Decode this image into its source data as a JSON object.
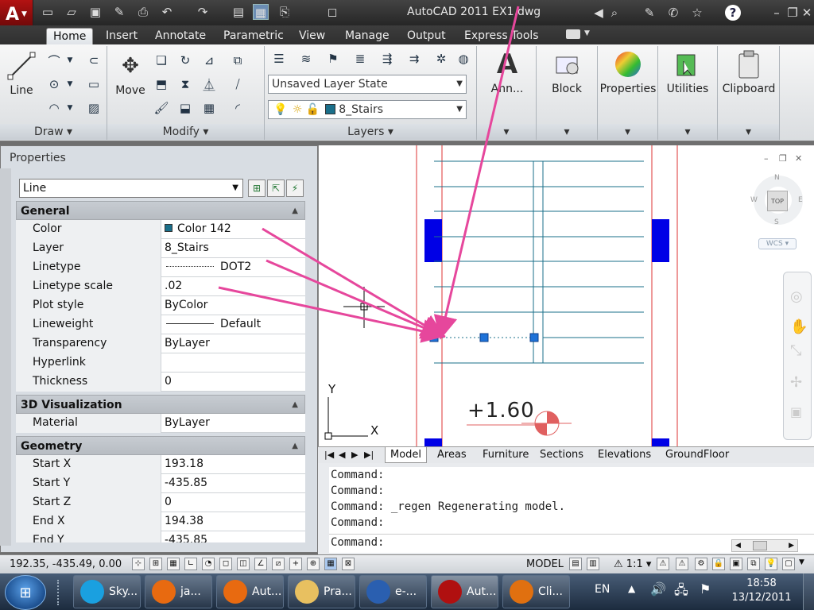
{
  "window": {
    "title": "AutoCAD 2011    EX1.dwg"
  },
  "ribbon": {
    "tabs": [
      "Home",
      "Insert",
      "Annotate",
      "Parametric",
      "View",
      "Manage",
      "Output",
      "Express Tools"
    ],
    "active_tab": "Home",
    "panels": {
      "draw": {
        "label": "Draw",
        "line": "Line"
      },
      "modify": {
        "label": "Modify",
        "move": "Move"
      },
      "layers": {
        "label": "Layers",
        "layer_state": "Unsaved Layer State",
        "current_layer": "8_Stairs",
        "layer_color": "#1a6f8a"
      },
      "annotation": {
        "label": "Ann..."
      },
      "block": {
        "label": "Block"
      },
      "properties": {
        "label": "Properties"
      },
      "utilities": {
        "label": "Utilities"
      },
      "clipboard": {
        "label": "Clipboard"
      }
    }
  },
  "properties_palette": {
    "title": "Properties",
    "object_type": "Line",
    "sections": {
      "general": {
        "title": "General",
        "rows": [
          {
            "label": "Color",
            "value": "Color 142",
            "swatch": "#1a6f8a"
          },
          {
            "label": "Layer",
            "value": "8_Stairs"
          },
          {
            "label": "Linetype",
            "value": "DOT2"
          },
          {
            "label": "Linetype scale",
            "value": ".02"
          },
          {
            "label": "Plot style",
            "value": "ByColor"
          },
          {
            "label": "Lineweight",
            "value": "Default"
          },
          {
            "label": "Transparency",
            "value": "ByLayer"
          },
          {
            "label": "Hyperlink",
            "value": ""
          },
          {
            "label": "Thickness",
            "value": "0"
          }
        ]
      },
      "visualization": {
        "title": "3D Visualization",
        "rows": [
          {
            "label": "Material",
            "value": "ByLayer"
          }
        ]
      },
      "geometry": {
        "title": "Geometry",
        "rows": [
          {
            "label": "Start X",
            "value": "193.18"
          },
          {
            "label": "Start Y",
            "value": "-435.85"
          },
          {
            "label": "Start Z",
            "value": "0"
          },
          {
            "label": "End X",
            "value": "194.38"
          },
          {
            "label": "End Y",
            "value": "-435.85"
          }
        ]
      }
    }
  },
  "drawing": {
    "elevation_label": "+1.60",
    "viewcube": {
      "north": "N",
      "south": "S",
      "east": "E",
      "west": "W",
      "face": "TOP",
      "ucs": "WCS"
    },
    "ucs_icon": {
      "x": "X",
      "y": "Y"
    }
  },
  "layout_tabs": [
    "Model",
    "Areas",
    "Furniture",
    "Sections",
    "Elevations",
    "GroundFloor"
  ],
  "active_layout": "Model",
  "command_lines": [
    "Command:",
    "Command:",
    "Command:  _regen Regenerating model.",
    "Command:"
  ],
  "command_prompt": "Command:",
  "status": {
    "coords": "192.35, -435.49, 0.00",
    "space": "MODEL",
    "annotation_scale": "1:1"
  },
  "taskbar": {
    "buttons": [
      {
        "label": "Sky...",
        "color": "#1aa0e0"
      },
      {
        "label": "ja...",
        "color": "#e86a10"
      },
      {
        "label": "Aut...",
        "color": "#e86a10"
      },
      {
        "label": "Pra...",
        "color": "#e8c060"
      },
      {
        "label": "e-...",
        "color": "#2a5fb0"
      },
      {
        "label": "Aut...",
        "color": "#b01010"
      },
      {
        "label": "Cli...",
        "color": "#e07010"
      }
    ],
    "language": "EN",
    "time": "18:58",
    "date": "13/12/2011"
  },
  "annotation_color": "#e6479c"
}
